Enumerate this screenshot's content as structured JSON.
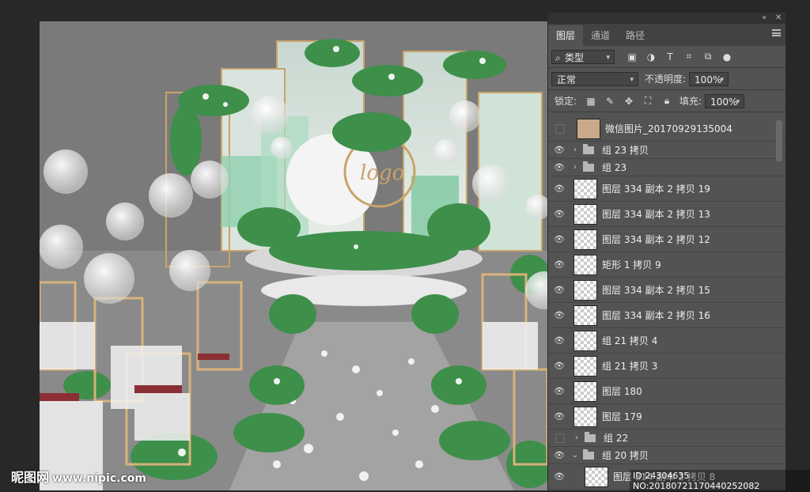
{
  "panel": {
    "tabs": [
      {
        "label": "图层",
        "active": true
      },
      {
        "label": "通道",
        "active": false
      },
      {
        "label": "路径",
        "active": false
      }
    ],
    "filter": {
      "value": "类型"
    },
    "filter_icons": [
      "image-filter-icon",
      "adjustment-filter-icon",
      "text-filter-icon",
      "shape-filter-icon",
      "smartobject-filter-icon",
      "filter-toggle-icon"
    ],
    "blend_mode": "正常",
    "opacity_label": "不透明度:",
    "opacity_value": "100%",
    "lock_label": "锁定:",
    "fill_label": "填充:",
    "fill_value": "100%"
  },
  "layers": [
    {
      "name": "微信图片_20170929135004",
      "visible": false,
      "type": "photo"
    },
    {
      "name": "组 23 拷贝",
      "visible": true,
      "type": "group",
      "expanded": false
    },
    {
      "name": "组 23",
      "visible": true,
      "type": "group",
      "expanded": false
    },
    {
      "name": "图层 334 副本 2 拷贝 19",
      "visible": true,
      "type": "layer"
    },
    {
      "name": "图层 334 副本 2 拷贝 13",
      "visible": true,
      "type": "layer"
    },
    {
      "name": "图层 334 副本 2 拷贝 12",
      "visible": true,
      "type": "layer"
    },
    {
      "name": "矩形 1 拷贝 9",
      "visible": true,
      "type": "layer"
    },
    {
      "name": "图层 334 副本 2 拷贝 15",
      "visible": true,
      "type": "layer"
    },
    {
      "name": "图层 334 副本 2 拷贝 16",
      "visible": true,
      "type": "layer"
    },
    {
      "name": "组 21 拷贝 4",
      "visible": true,
      "type": "layer"
    },
    {
      "name": "组 21 拷贝 3",
      "visible": true,
      "type": "layer"
    },
    {
      "name": "图层 180",
      "visible": true,
      "type": "layer"
    },
    {
      "name": "图层 179",
      "visible": true,
      "type": "layer"
    },
    {
      "name": "组 22",
      "visible": false,
      "type": "group",
      "expanded": false
    },
    {
      "name": "组 20 拷贝",
      "visible": true,
      "type": "group",
      "expanded": true
    },
    {
      "name": "图层 334 副本 2 拷贝 8",
      "visible": true,
      "type": "layer",
      "indent": true
    }
  ],
  "canvas": {
    "logo_text": "logo"
  },
  "watermark": {
    "site": "昵图网",
    "url": "www.nipic.com",
    "id_text": "ID:24304635 NO:20180721170440252082"
  }
}
